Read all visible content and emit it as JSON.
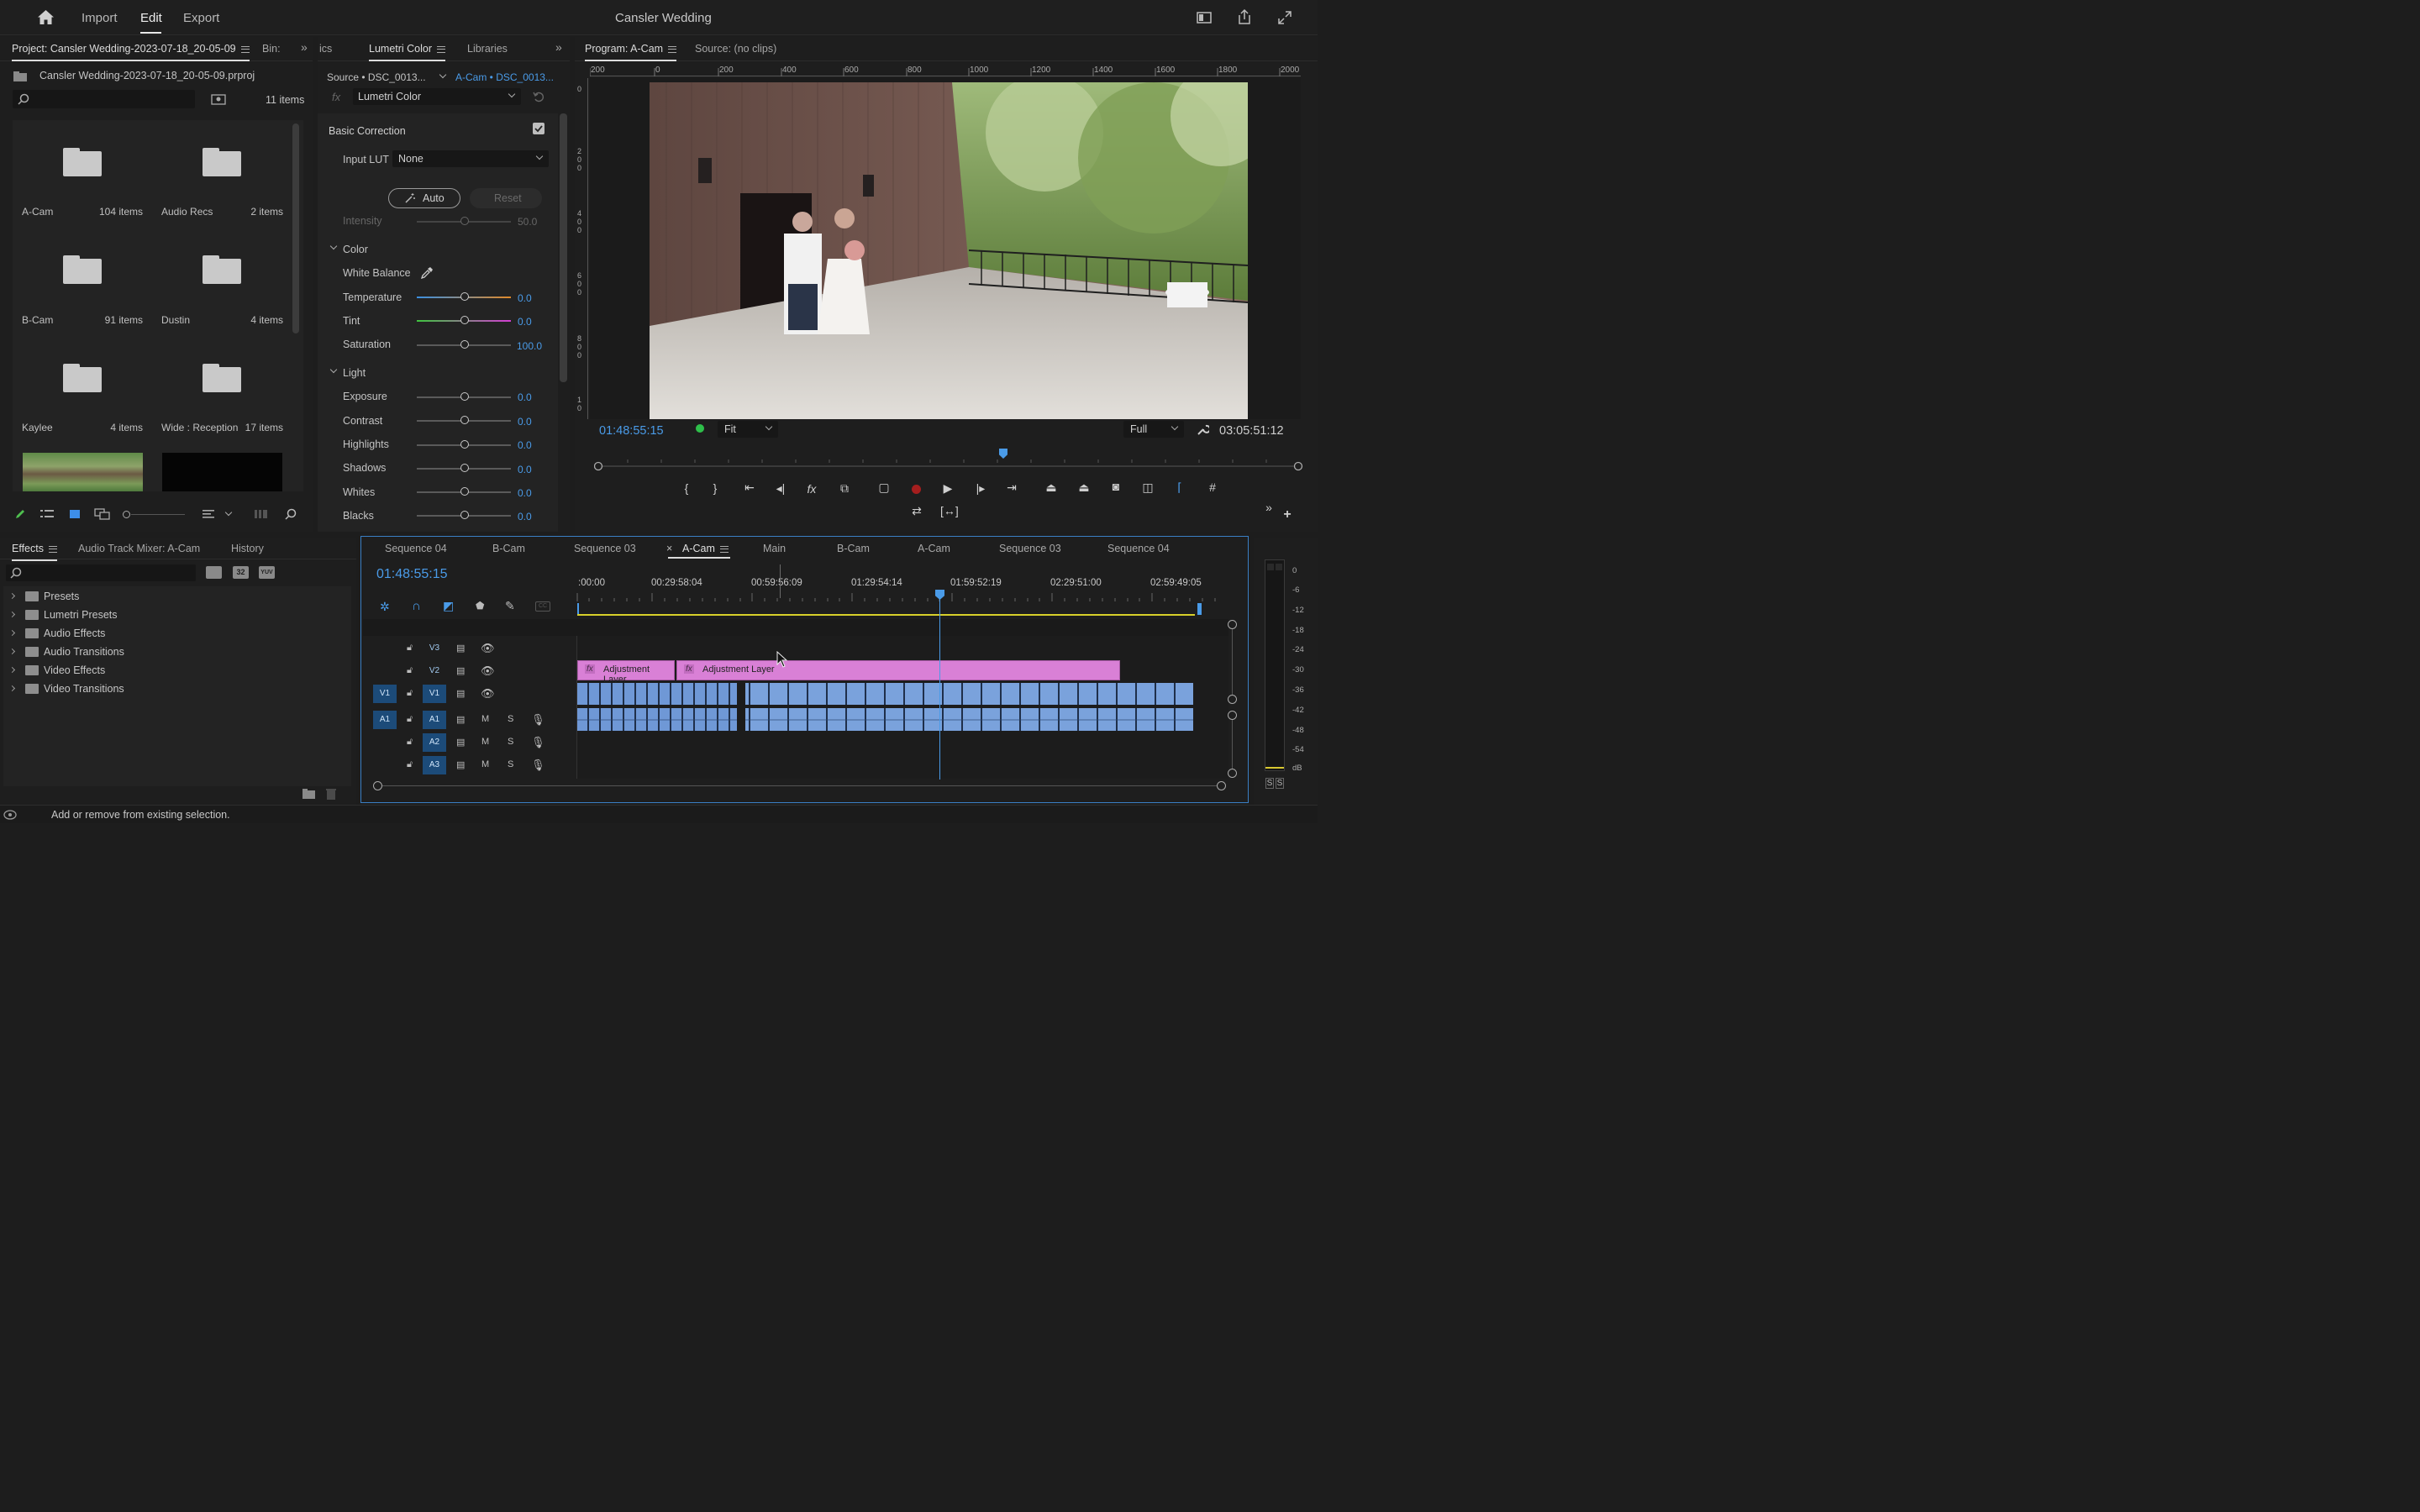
{
  "app": {
    "title": "Cansler Wedding",
    "nav": [
      "Import",
      "Edit",
      "Export"
    ],
    "active_nav": "Edit"
  },
  "project": {
    "tab_label": "Project: Cansler Wedding-2023-07-18_20-05-09",
    "tab_bins": "Bin:",
    "file_name": "Cansler Wedding-2023-07-18_20-05-09.prproj",
    "item_count": "11 items",
    "search_placeholder": "",
    "bins": [
      {
        "name": "A-Cam",
        "count": "104 items"
      },
      {
        "name": "Audio Recs",
        "count": "2 items"
      },
      {
        "name": "B-Cam",
        "count": "91 items"
      },
      {
        "name": "Dustin",
        "count": "4 items"
      },
      {
        "name": "Kaylee",
        "count": "4 items"
      },
      {
        "name": "Wide : Reception",
        "count": "17 items"
      }
    ]
  },
  "lumetri": {
    "tab_prev": "ics",
    "tab_label": "Lumetri Color",
    "tab_libraries": "Libraries",
    "source_label": "Source • DSC_0013...",
    "target_label": "A-Cam • DSC_0013...",
    "effect_select": "Lumetri Color",
    "section_basic": "Basic Correction",
    "input_lut_label": "Input LUT",
    "input_lut_value": "None",
    "auto_label": "Auto",
    "reset_label": "Reset",
    "intensity_label": "Intensity",
    "intensity_value": "50.0",
    "color_section": "Color",
    "white_balance_label": "White Balance",
    "light_section": "Light",
    "color_rows": [
      {
        "label": "Temperature",
        "value": "0.0"
      },
      {
        "label": "Tint",
        "value": "0.0"
      },
      {
        "label": "Saturation",
        "value": "100.0"
      }
    ],
    "light_rows": [
      {
        "label": "Exposure",
        "value": "0.0"
      },
      {
        "label": "Contrast",
        "value": "0.0"
      },
      {
        "label": "Highlights",
        "value": "0.0"
      },
      {
        "label": "Shadows",
        "value": "0.0"
      },
      {
        "label": "Whites",
        "value": "0.0"
      },
      {
        "label": "Blacks",
        "value": "0.0"
      }
    ]
  },
  "program": {
    "tab_label": "Program: A-Cam",
    "source_tab": "Source: (no clips)",
    "timecode": "01:48:55:15",
    "fit_label": "Fit",
    "quality_label": "Full",
    "duration": "03:05:51:12",
    "ruler_labels": [
      "200",
      "0",
      "200",
      "400",
      "600",
      "800",
      "1000",
      "1200",
      "1400",
      "1600",
      "1800",
      "2000"
    ],
    "v_ruler_labels": [
      "0",
      "2 0 0",
      "4 0 0",
      "6 0 0",
      "8 0 0",
      "1 0"
    ],
    "playhead_fraction": 0.58
  },
  "effects": {
    "tab_label": "Effects",
    "tab_mixer": "Audio Track Mixer: A-Cam",
    "tab_history": "History",
    "badge_32": "32",
    "badge_yuv": "YUV",
    "items": [
      "Presets",
      "Lumetri Presets",
      "Audio Effects",
      "Audio Transitions",
      "Video Effects",
      "Video Transitions"
    ]
  },
  "timeline": {
    "tabs": [
      "Sequence 04",
      "B-Cam",
      "Sequence 03",
      "A-Cam",
      "Main",
      "B-Cam",
      "A-Cam",
      "Sequence 03",
      "Sequence 04"
    ],
    "active_tab": "A-Cam",
    "timecode": "01:48:55:15",
    "ruler_labels": [
      ":00:00",
      "00:29:58:04",
      "00:59:56:09",
      "01:29:54:14",
      "01:59:52:19",
      "02:29:51:00",
      "02:59:49:05"
    ],
    "tracks": [
      {
        "id": "V3",
        "src": ""
      },
      {
        "id": "V2",
        "src": ""
      },
      {
        "id": "V1",
        "src": "V1"
      },
      {
        "id": "A1",
        "src": "A1"
      },
      {
        "id": "A2",
        "src": ""
      },
      {
        "id": "A3",
        "src": ""
      }
    ],
    "mute_label": "M",
    "solo_label": "S",
    "clip_1": "Adjustment Layer",
    "clip_2": "Adjustment Layer",
    "fx_badge": "fx"
  },
  "meter": {
    "labels": [
      "0",
      "-6",
      "-12",
      "-18",
      "-24",
      "-30",
      "-36",
      "-42",
      "-48",
      "-54",
      "dB"
    ],
    "solo_labels": [
      "S",
      "S"
    ]
  },
  "status": {
    "text": "Add or remove from existing selection."
  },
  "colors": {
    "accent_blue": "#4a9be8",
    "adjustment_pink": "#d980d6",
    "clip_blue": "#6f98d6",
    "work_area_yellow": "#d8d02a"
  }
}
